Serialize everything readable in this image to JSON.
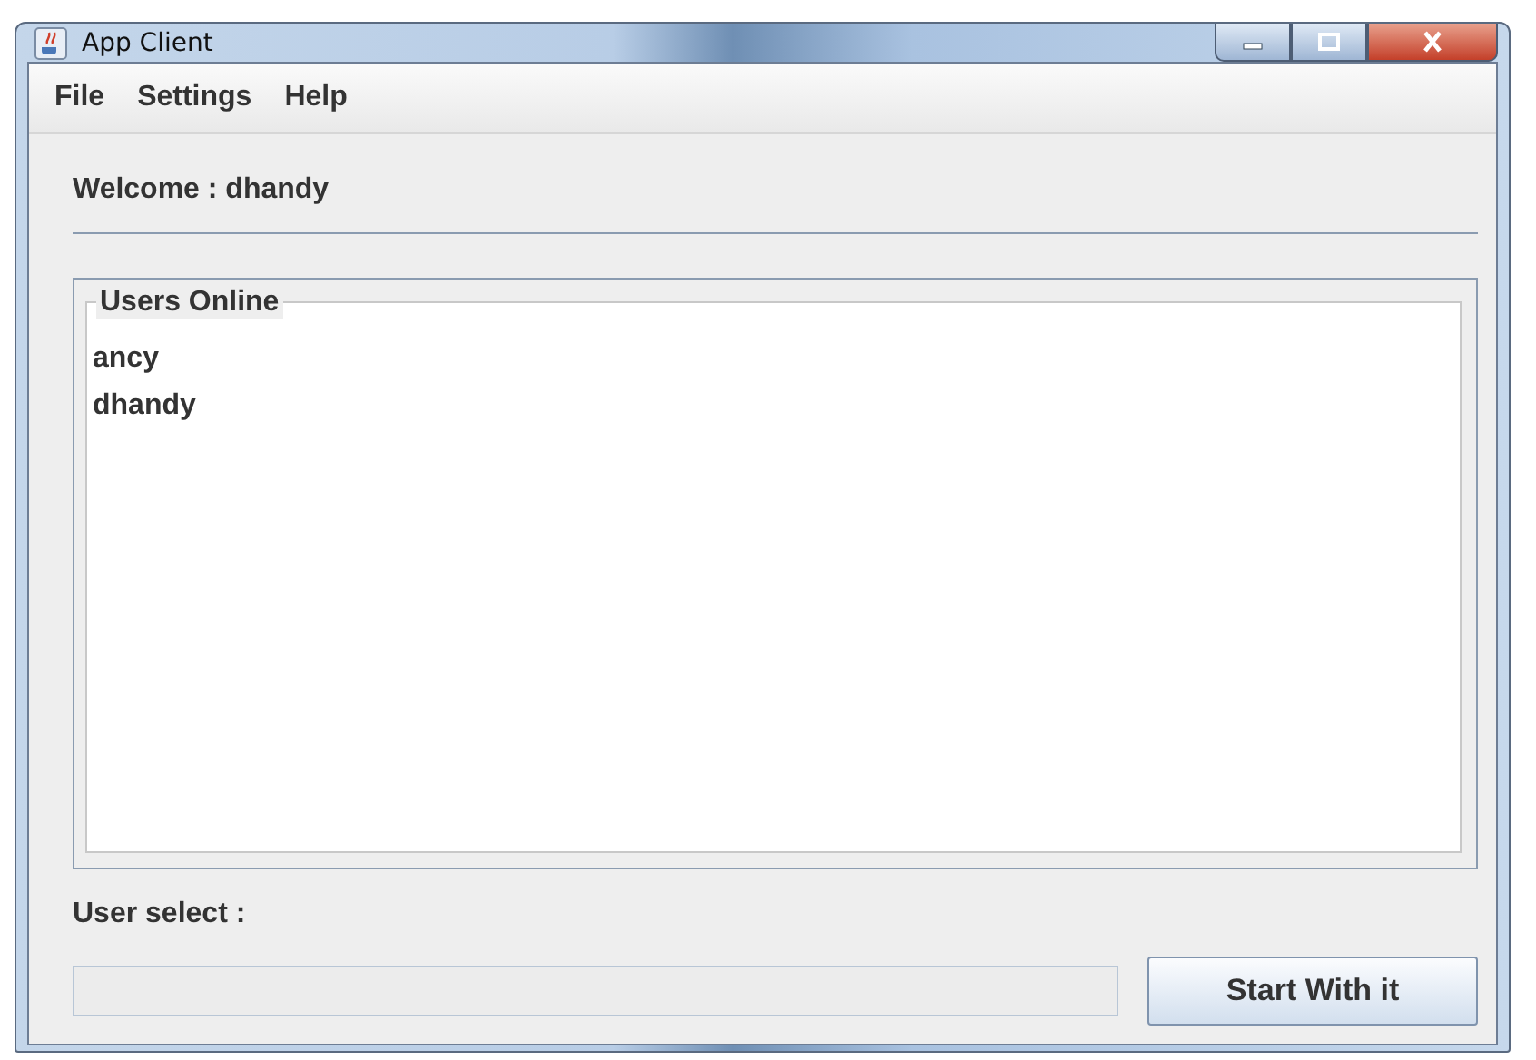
{
  "window": {
    "title": "App Client"
  },
  "menu": [
    "File",
    "Settings",
    "Help"
  ],
  "welcome": "Welcome : dhandy",
  "users_panel": {
    "title": "Users Online",
    "users": [
      "ancy",
      "dhandy"
    ]
  },
  "select_label": "User select :",
  "button": "Start With it"
}
